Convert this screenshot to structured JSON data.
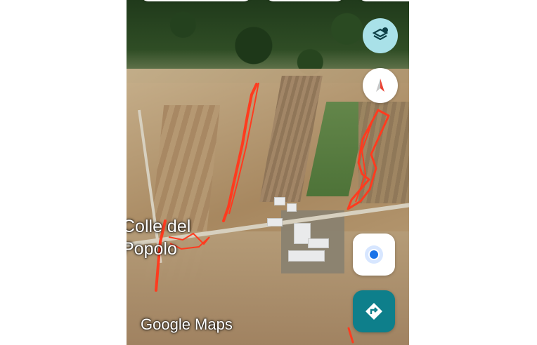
{
  "map": {
    "place_label_line1": "Colle del",
    "place_label_line2": "Popolo",
    "brand": "Google Maps",
    "controls": {
      "layers_icon": "layers-icon",
      "compass_icon": "compass-icon",
      "location_icon": "location-dot-icon",
      "directions_icon": "directions-icon"
    },
    "colors": {
      "track": "#ff3b1f",
      "layers_button": "#a9e1e8",
      "directions_button": "#0e7f8b",
      "location_dot": "#1a73e8"
    }
  }
}
